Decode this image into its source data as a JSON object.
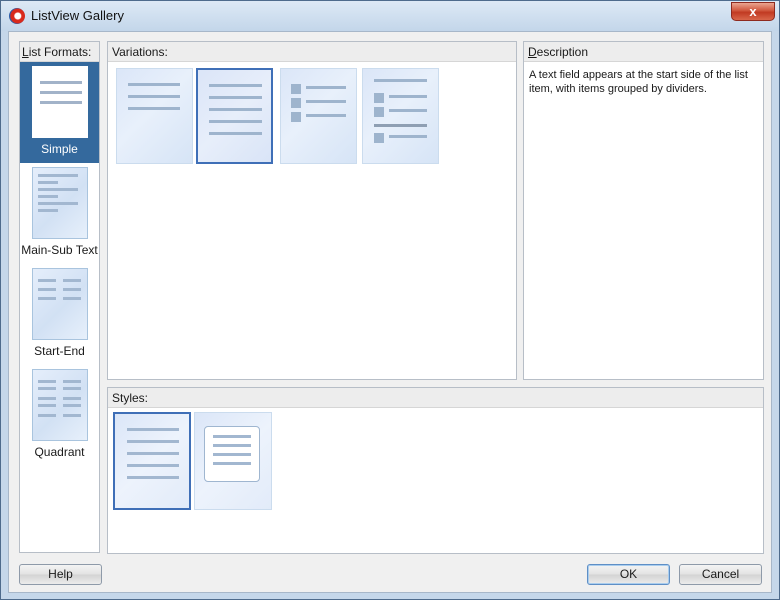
{
  "window": {
    "title": "ListView Gallery",
    "close_label": "x"
  },
  "formats": {
    "header": "List Formats:",
    "items": [
      {
        "label": "Simple",
        "selected": true
      },
      {
        "label": "Main-Sub Text",
        "selected": false
      },
      {
        "label": "Start-End",
        "selected": false
      },
      {
        "label": "Quadrant",
        "selected": false
      }
    ]
  },
  "variations": {
    "header": "Variations:",
    "selected_index": 1,
    "count": 4
  },
  "description": {
    "header": "Description",
    "text": "A text field appears at the start side of the list item, with items grouped by dividers."
  },
  "styles": {
    "header": "Styles:",
    "selected_index": 0,
    "count": 2
  },
  "buttons": {
    "help": "Help",
    "ok": "OK",
    "cancel": "Cancel"
  },
  "colors": {
    "selection": "#34699d",
    "accent_border": "#3f6fb7"
  }
}
